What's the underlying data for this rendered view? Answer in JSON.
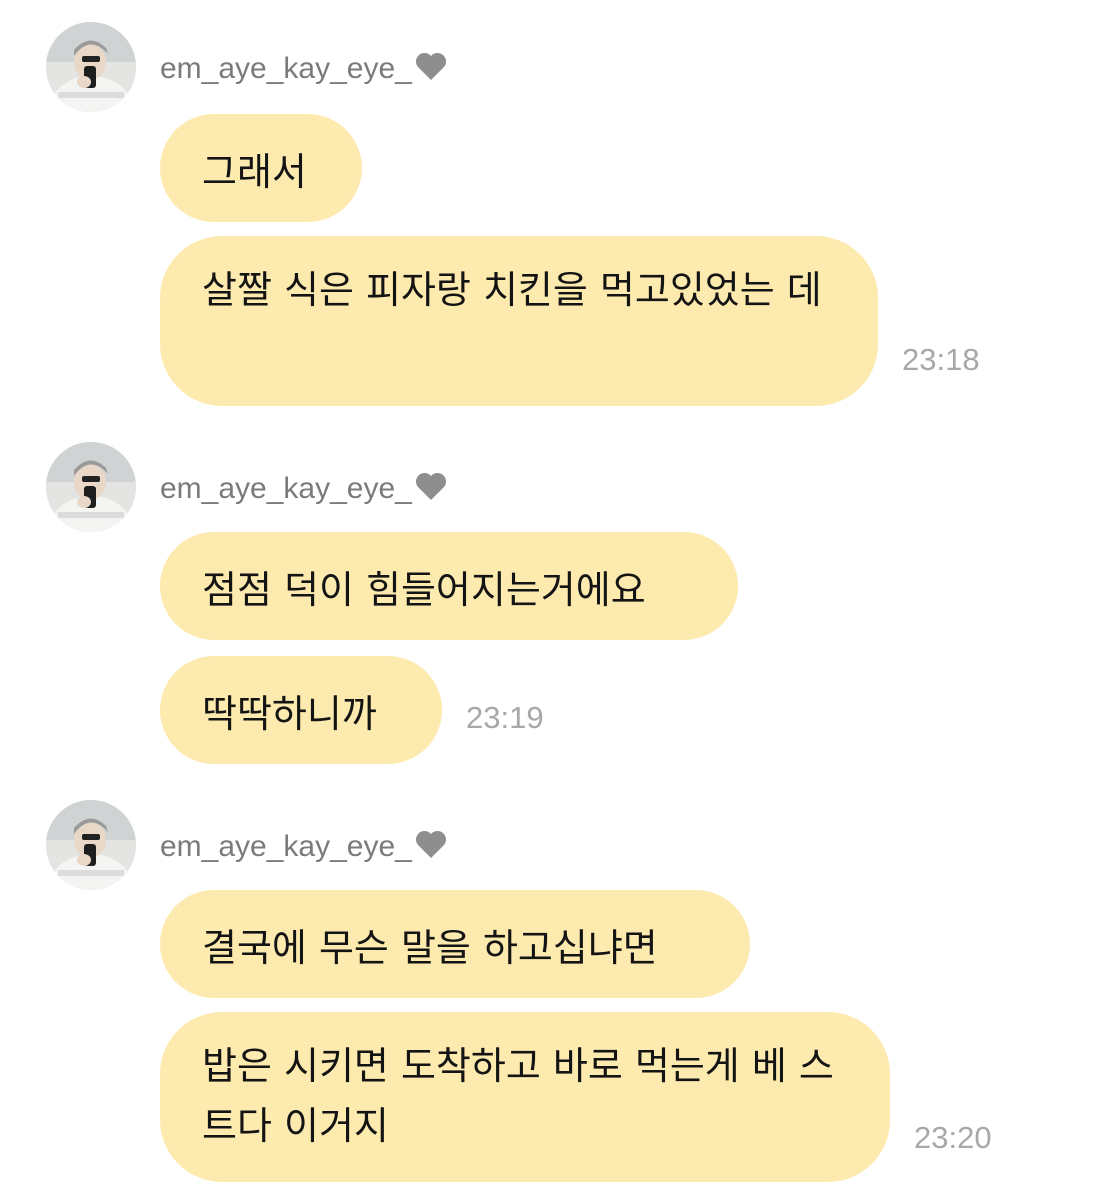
{
  "groups": [
    {
      "username": "em_aye_kay_eye_",
      "messages": [
        "그래서",
        "살짤 식은 피자랑 치킨을 먹고있었는 데"
      ],
      "time": "23:18"
    },
    {
      "username": "em_aye_kay_eye_",
      "messages": [
        "점점 덕이 힘들어지는거에요",
        "딱딱하니까"
      ],
      "time": "23:19"
    },
    {
      "username": "em_aye_kay_eye_",
      "messages": [
        "결국에 무슨 말을 하고십냐면",
        "밥은 시키면 도착하고 바로 먹는게 베 스트다 이거지"
      ],
      "time": "23:20"
    }
  ],
  "icons": {
    "avatar": "profile-photo",
    "heart": "grey-heart-icon"
  },
  "colors": {
    "bubble": "#fdeaae",
    "username": "#7b7b7b",
    "timestamp": "#a8a8a8"
  }
}
